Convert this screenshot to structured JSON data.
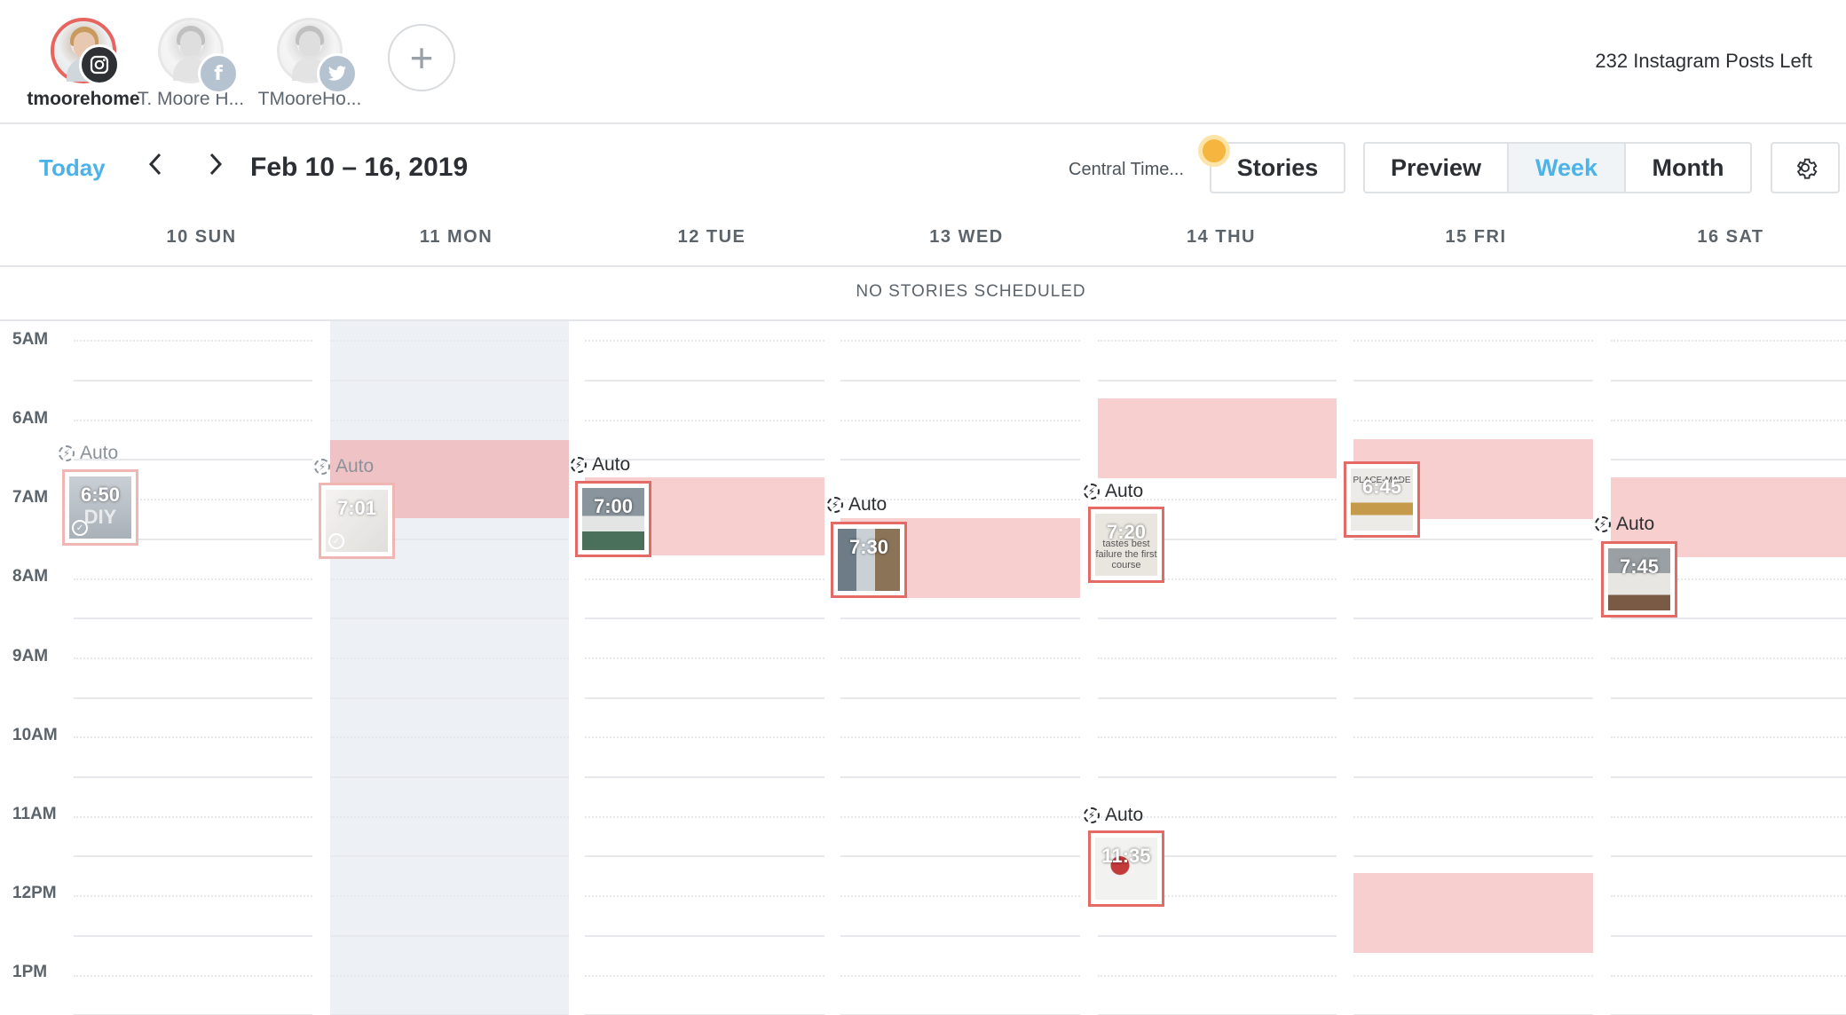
{
  "accounts": [
    {
      "name": "tmoorehome",
      "network": "instagram-icon",
      "active": true
    },
    {
      "name": "T. Moore H...",
      "network": "facebook-icon",
      "active": false
    },
    {
      "name": "TMooreHo...",
      "network": "twitter-icon",
      "active": false
    }
  ],
  "add_account_label": "+",
  "posts_left": "232 Instagram Posts Left",
  "toolbar": {
    "today": "Today",
    "prev": "‹",
    "next": "›",
    "date_range": "Feb 10 – 16, 2019",
    "timezone": "Central Time...",
    "stories": "Stories",
    "preview": "Preview",
    "week": "Week",
    "month": "Month"
  },
  "days": [
    "10 SUN",
    "11 MON",
    "12 TUE",
    "13 WED",
    "14 THU",
    "15 FRI",
    "16 SAT"
  ],
  "stories_banner": "NO STORIES SCHEDULED",
  "hours": [
    "5AM",
    "6AM",
    "7AM",
    "8AM",
    "9AM",
    "10AM",
    "11AM",
    "12PM",
    "1PM"
  ],
  "auto_label": "Auto",
  "posts": [
    {
      "day": "10 SUN",
      "time": "6:50",
      "text": "DIY",
      "status": "published"
    },
    {
      "day": "11 MON",
      "time": "7:01",
      "text": "",
      "status": "published"
    },
    {
      "day": "12 TUE",
      "time": "7:00",
      "text": "",
      "status": "scheduled"
    },
    {
      "day": "13 WED",
      "time": "7:30",
      "text": "",
      "status": "scheduled"
    },
    {
      "day": "14 THU",
      "time": "7:20",
      "text": "tastes best failure the first course",
      "status": "scheduled"
    },
    {
      "day": "15 FRI",
      "time": "6:45",
      "text": "PLACE-MADE",
      "status": "scheduled"
    },
    {
      "day": "16 SAT",
      "time": "7:45",
      "text": "",
      "status": "scheduled"
    },
    {
      "day": "14 THU",
      "time": "11:35",
      "text": "",
      "status": "scheduled"
    }
  ],
  "colors": {
    "accent": "#4cb3e8",
    "slot": "#f7cfcf",
    "post_border": "#e46a66",
    "story_dot": "#f5b53f"
  }
}
